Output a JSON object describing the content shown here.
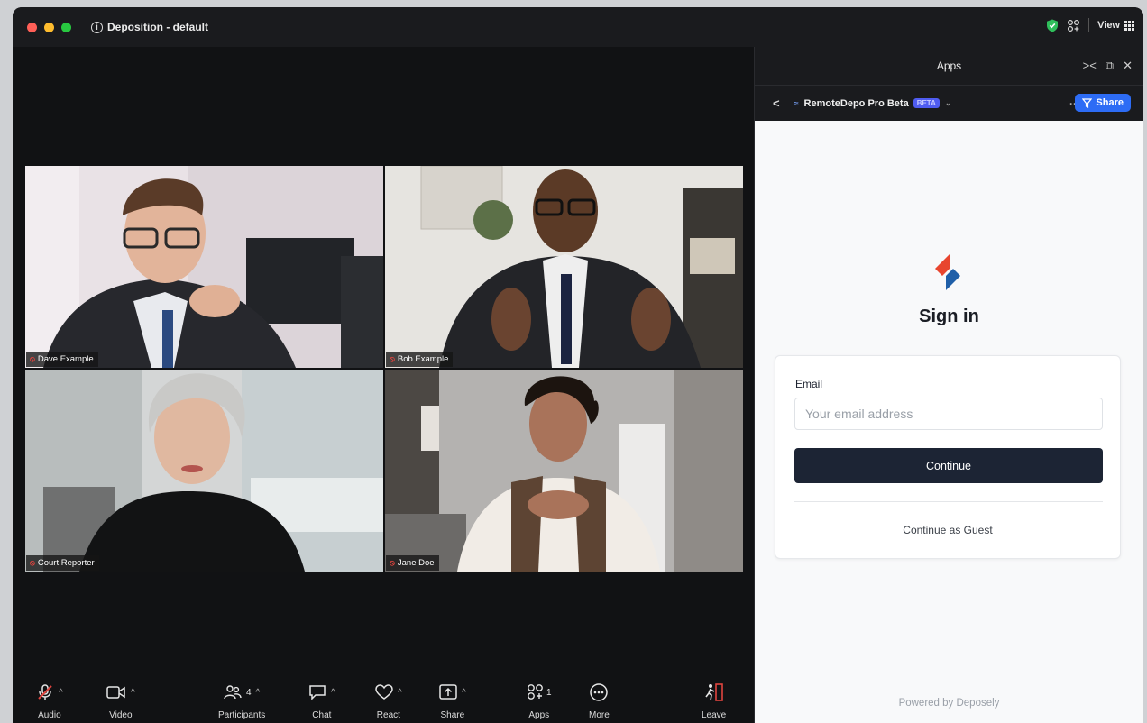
{
  "window": {
    "title": "Deposition - default",
    "view_label": "View",
    "traffic_lights": [
      "#ff5f57",
      "#febc2e",
      "#28c840"
    ]
  },
  "participants": [
    {
      "name": "Dave Example",
      "muted": true
    },
    {
      "name": "Bob Example",
      "muted": true
    },
    {
      "name": "Court Reporter",
      "muted": true
    },
    {
      "name": "Jane Doe",
      "muted": true
    }
  ],
  "toolbar": {
    "audio": "Audio",
    "video": "Video",
    "participants": "Participants",
    "participants_count": "4",
    "chat": "Chat",
    "react": "React",
    "share": "Share",
    "apps": "Apps",
    "apps_count": "1",
    "more": "More",
    "leave": "Leave"
  },
  "panel": {
    "header_title": "Apps",
    "app_name": "RemoteDepo Pro Beta",
    "beta_badge": "BETA",
    "share_label": "Share"
  },
  "signin": {
    "title": "Sign in",
    "email_label": "Email",
    "email_placeholder": "Your email address",
    "email_value": "",
    "continue_label": "Continue",
    "guest_label": "Continue as Guest",
    "footer": "Powered by Deposely"
  },
  "colors": {
    "accent": "#2d6cf5",
    "primary_button": "#1c2434",
    "muted_icon": "#e0443e",
    "shield": "#2fbf5b"
  }
}
